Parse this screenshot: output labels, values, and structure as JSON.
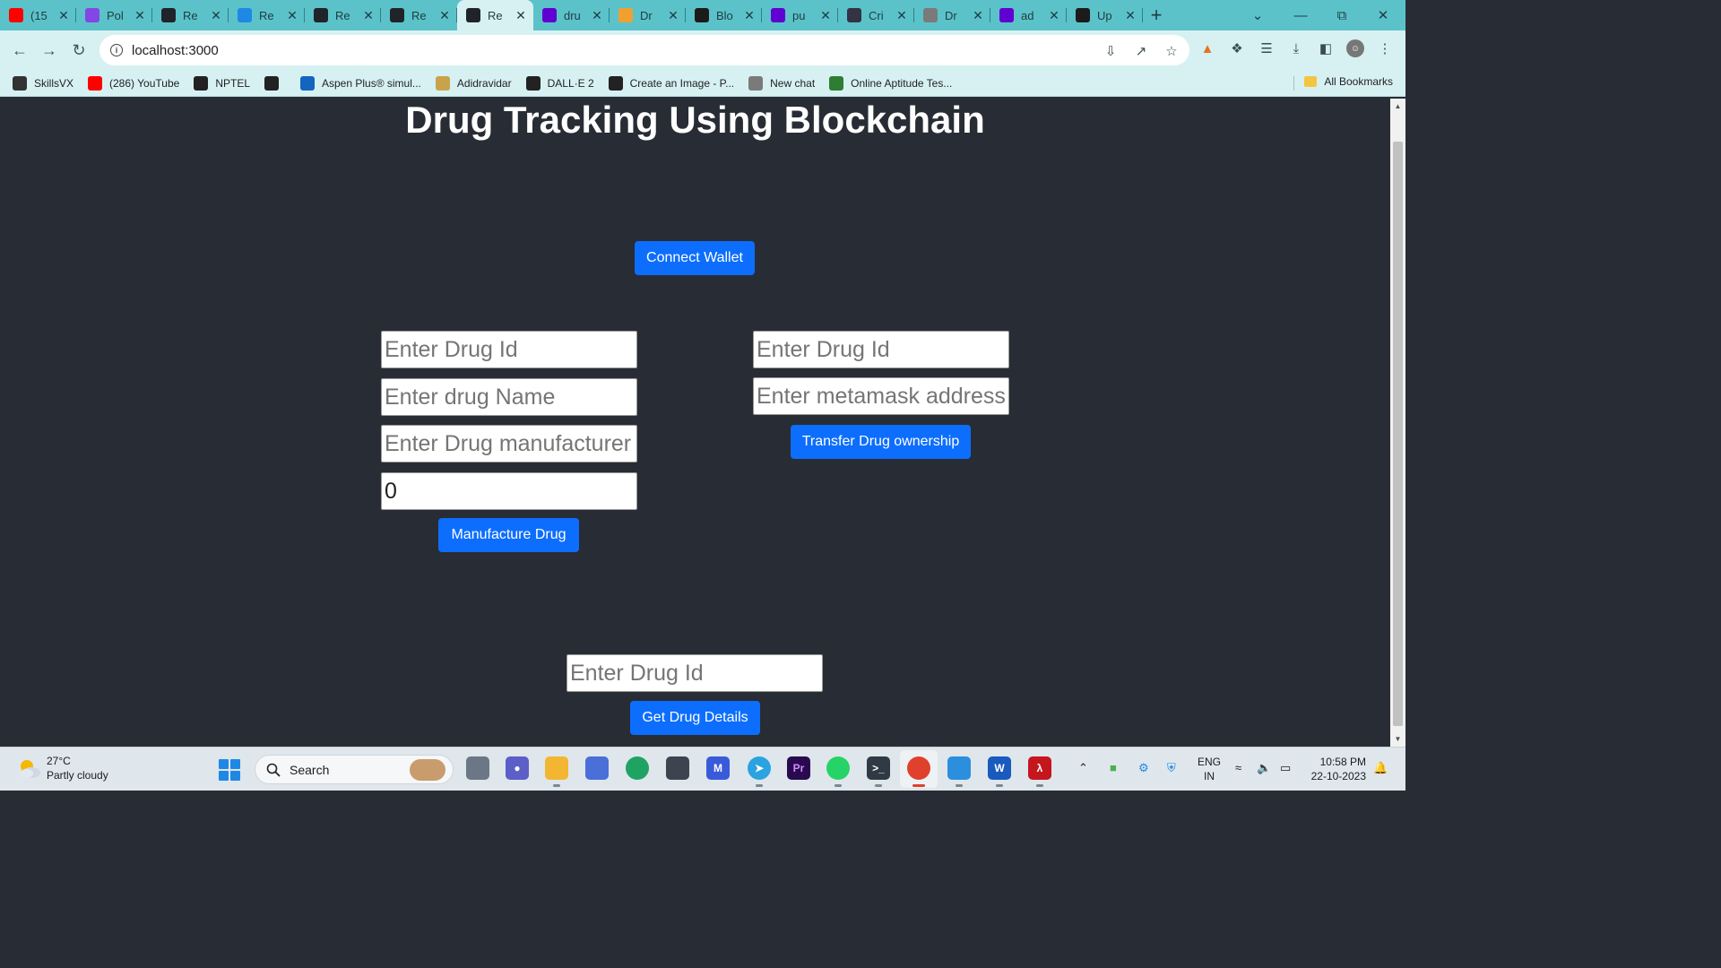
{
  "browser": {
    "tabs": [
      {
        "label": "(15",
        "favicon": "youtube-icon",
        "color": "#ff0000"
      },
      {
        "label": "Pol",
        "favicon": "polygon-icon",
        "color": "#8247e5"
      },
      {
        "label": "Re",
        "favicon": "react-icon",
        "color": "#20232a"
      },
      {
        "label": "Re",
        "favicon": "remix-icon",
        "color": "#1e88e5"
      },
      {
        "label": "Re",
        "favicon": "react-icon",
        "color": "#20232a"
      },
      {
        "label": "Re",
        "favicon": "react-icon",
        "color": "#20232a"
      },
      {
        "label": "Re",
        "favicon": "react-icon",
        "color": "#20232a",
        "active": true
      },
      {
        "label": "dru",
        "favicon": "yahoo-icon",
        "color": "#6001d2"
      },
      {
        "label": "Dr",
        "favicon": "e-icon",
        "color": "#f0a030"
      },
      {
        "label": "Blo",
        "favicon": "s-icon",
        "color": "#1b1b1b"
      },
      {
        "label": "pu",
        "favicon": "yahoo-icon",
        "color": "#6001d2"
      },
      {
        "label": "Cri",
        "favicon": "arrow-icon",
        "color": "#334"
      },
      {
        "label": "Dr",
        "favicon": "openai-icon",
        "color": "#7a7a7a"
      },
      {
        "label": "ad",
        "favicon": "yahoo-icon",
        "color": "#6001d2"
      },
      {
        "label": "Up",
        "favicon": "github-icon",
        "color": "#1b1b1b"
      }
    ],
    "url": "localhost:3000",
    "bookmarks": [
      {
        "label": "SkillsVX",
        "icon": "skillsvx-icon",
        "color": "#333"
      },
      {
        "label": "(286) YouTube",
        "icon": "youtube-icon",
        "color": "#ff0000"
      },
      {
        "label": "NPTEL",
        "icon": "globe-icon",
        "color": "#222"
      },
      {
        "label": "",
        "icon": "globe-icon",
        "color": "#222"
      },
      {
        "label": "Aspen Plus® simul...",
        "icon": "s-icon",
        "color": "#1565c0"
      },
      {
        "label": "Adidravidar",
        "icon": "avatar-icon",
        "color": "#c9a34a"
      },
      {
        "label": "DALL·E 2",
        "icon": "openai-icon",
        "color": "#222"
      },
      {
        "label": "Create an Image - P...",
        "icon": "circle-icon",
        "color": "#222"
      },
      {
        "label": "New chat",
        "icon": "openai-icon",
        "color": "#7a7a7a"
      },
      {
        "label": "Online Aptitude Tes...",
        "icon": "umbrella-icon",
        "color": "#2e7d32"
      }
    ],
    "all_bookmarks": "All Bookmarks"
  },
  "app": {
    "title": "Drug Tracking Using Blockchain",
    "connect_wallet": "Connect Wallet",
    "manufacture": {
      "drug_id_placeholder": "Enter Drug Id",
      "drug_name_placeholder": "Enter drug Name",
      "manufacturer_placeholder": "Enter Drug manufacturer",
      "quantity_value": "0",
      "button": "Manufacture Drug"
    },
    "transfer": {
      "drug_id_placeholder": "Enter Drug Id",
      "address_placeholder": "Enter metamask address",
      "button": "Transfer Drug ownership"
    },
    "details": {
      "drug_id_placeholder": "Enter Drug Id",
      "button": "Get Drug Details"
    }
  },
  "taskbar": {
    "weather_temp": "27°C",
    "weather_desc": "Partly cloudy",
    "search_label": "Search",
    "lang_line1": "ENG",
    "lang_line2": "IN",
    "time": "10:58 PM",
    "date": "22-10-2023"
  }
}
